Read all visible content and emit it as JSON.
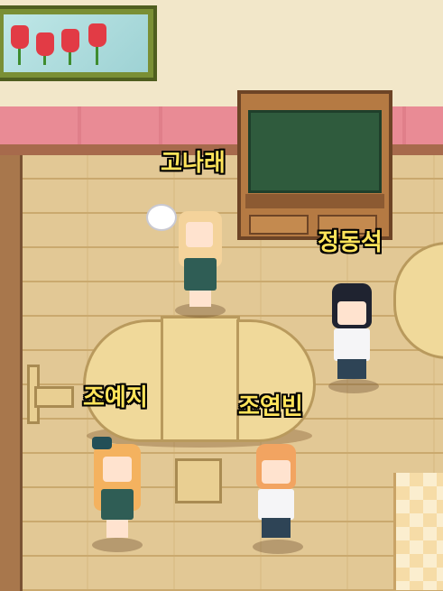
{
  "scene": {
    "type": "classroom"
  },
  "characters": [
    {
      "id": "gonarae",
      "name": "고나래"
    },
    {
      "id": "jeongdongseok",
      "name": "정동석"
    },
    {
      "id": "joyeji",
      "name": "조예지"
    },
    {
      "id": "joyeonbin",
      "name": "조연빈"
    }
  ],
  "colors": {
    "name_text": "#ffe45a",
    "name_outline": "#000000",
    "chalkboard": "#2f5b3d",
    "wall_stripe": "#e98b95",
    "floor": "#e2c895"
  },
  "icons": {
    "wall_picture": "tulip-painting-icon",
    "held_item": "feather-duster-icon"
  }
}
